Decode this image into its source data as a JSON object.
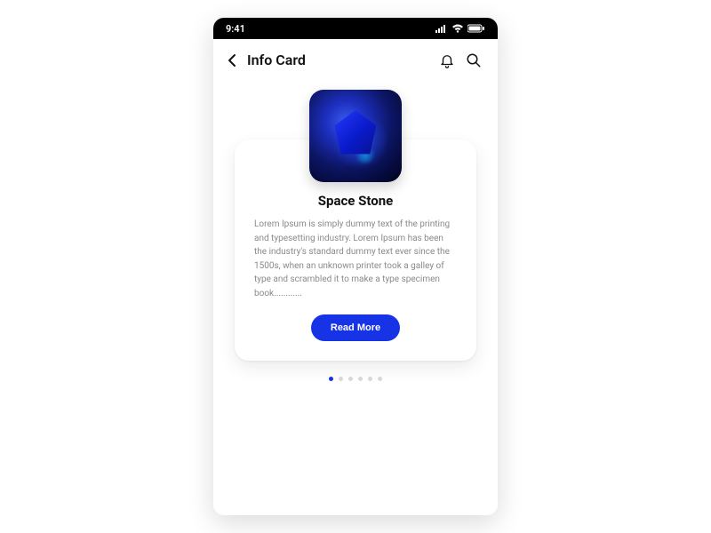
{
  "statusbar": {
    "time": "9:41"
  },
  "header": {
    "title": "Info Card"
  },
  "card": {
    "title": "Space Stone",
    "description": "Lorem Ipsum is simply dummy text of the printing and typesetting industry. Lorem Ipsum has been the industry's standard dummy text ever since the 1500s, when an unknown printer took a galley of type and scrambled it to make a type specimen book............",
    "button_label": "Read More"
  },
  "pagination": {
    "count": 6,
    "active_index": 0
  },
  "colors": {
    "accent": "#1633e6"
  }
}
